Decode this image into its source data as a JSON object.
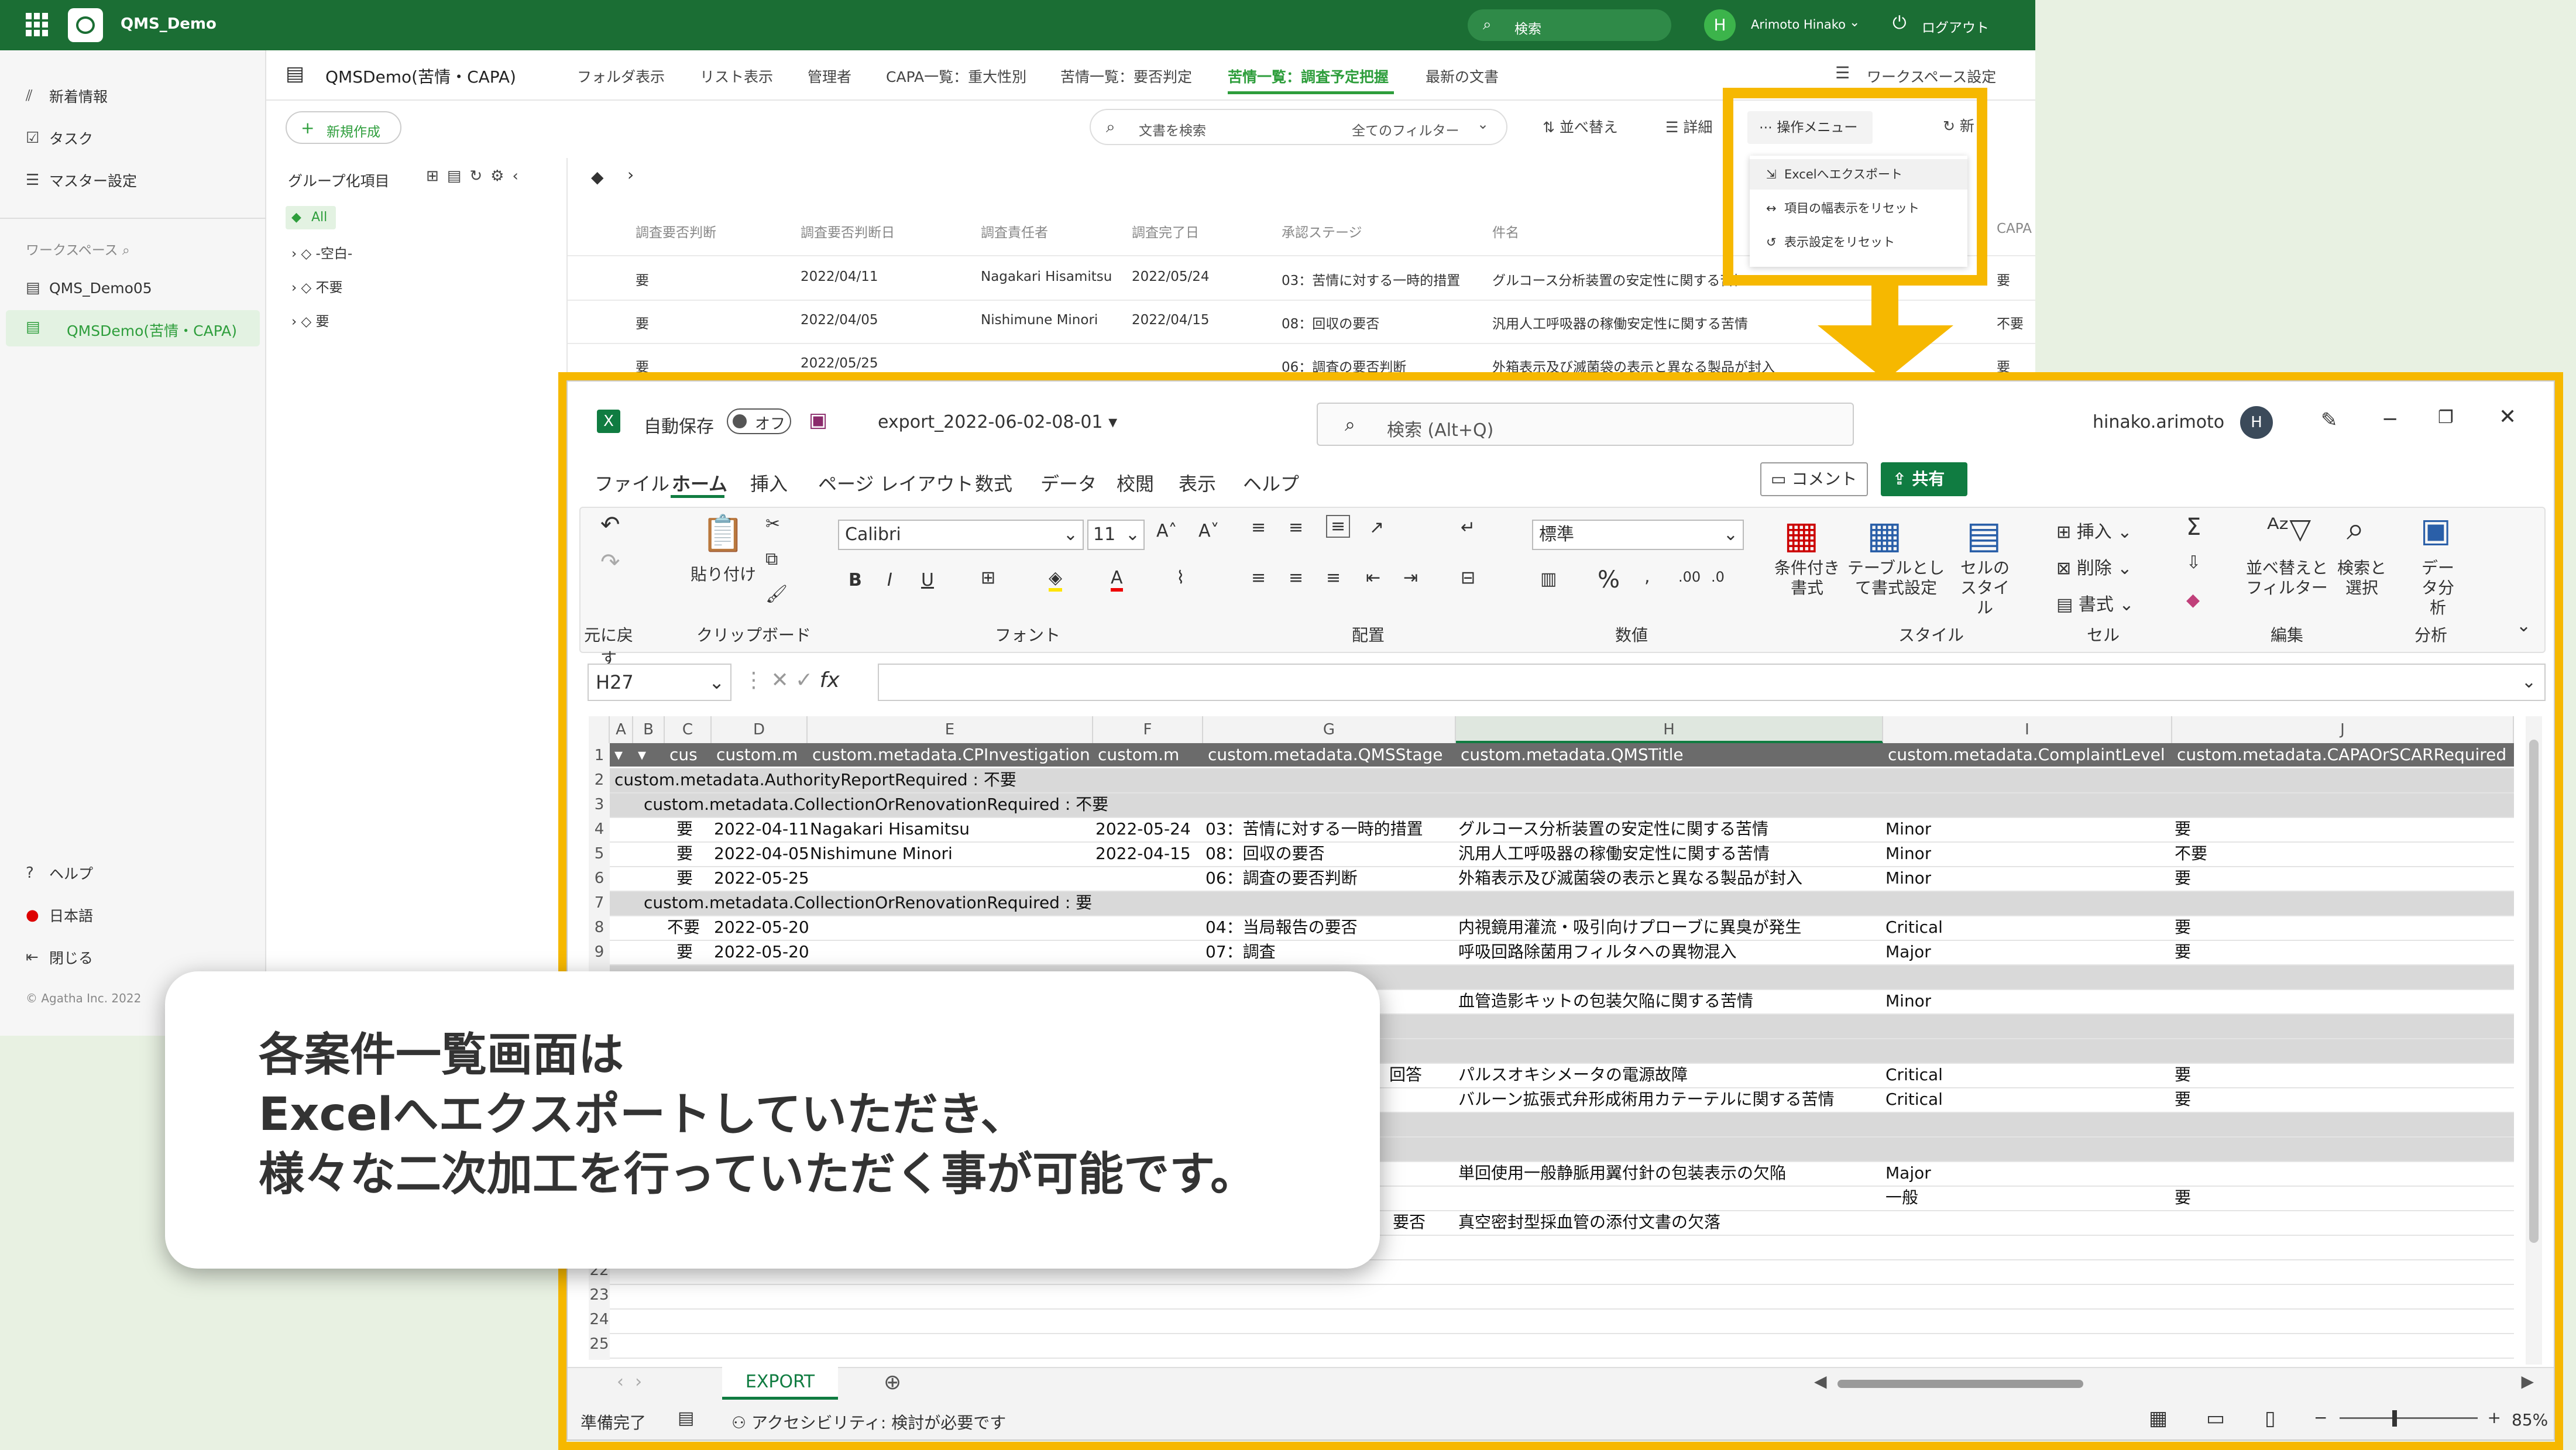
{
  "qms": {
    "app_title": "QMS_Demo",
    "search_placeholder": "検索",
    "user_initial": "H",
    "user_name": "Arimoto Hinako",
    "logout": "ログアウト",
    "nav": {
      "news": "新着情報",
      "task": "タスク",
      "master": "マスター設定",
      "workspace_header": "ワークスペース",
      "ws1": "QMS_Demo05",
      "ws2": "QMSDemo(苦情・CAPA)",
      "help": "ヘルプ",
      "lang": "日本語",
      "close": "閉じる",
      "copyright": "© Agatha Inc. 2022"
    },
    "workspace_title": "QMSDemo(苦情・CAPA)",
    "tabs": [
      "フォルダ表示",
      "リスト表示",
      "管理者",
      "CAPA一覧：重大性別",
      "苦情一覧：要否判定",
      "苦情一覧：調査予定把握",
      "最新の文書"
    ],
    "workspace_settings": "ワークスペース設定",
    "new_button": "新規作成",
    "doc_search_placeholder": "文書を検索",
    "all_filters": "全てのフィルター",
    "sort": "並べ替え",
    "detail": "詳細",
    "ops_menu": "操作メニュー",
    "refresh": "新",
    "ops_items": [
      "Excelへエクスポート",
      "項目の幅表示をリセット",
      "表示設定をリセット"
    ],
    "group_title": "グループ化項目",
    "groups": [
      "All",
      "-空白-",
      "不要",
      "要"
    ],
    "grid_headers": [
      "調査要否判断",
      "調査要否判断日",
      "調査責任者",
      "調査完了日",
      "承認ステージ",
      "件名",
      "CAPA"
    ],
    "grid_rows": [
      [
        "要",
        "2022/04/11",
        "Nagakari Hisamitsu",
        "2022/05/24",
        "03：苦情に対する一時的措置",
        "グルコース分析装置の安定性に関する苦情",
        "要"
      ],
      [
        "要",
        "2022/04/05",
        "Nishimune Minori",
        "2022/04/15",
        "08：回収の要否",
        "汎用人工呼吸器の稼働安定性に関する苦情",
        "不要"
      ],
      [
        "要",
        "2022/05/25",
        "",
        "",
        "06：調査の要否判断",
        "外箱表示及び滅菌袋の表示と異なる製品が封入",
        "要"
      ]
    ]
  },
  "excel": {
    "autosave": "自動保存",
    "autosave_state": "オフ",
    "filename": "export_2022-06-02-08-01",
    "search": "検索 (Alt+Q)",
    "user": "hinako.arimoto",
    "user_initial": "H",
    "menu": [
      "ファイル",
      "ホーム",
      "挿入",
      "ページ レイアウト",
      "数式",
      "データ",
      "校閲",
      "表示",
      "ヘルプ"
    ],
    "comment": "コメント",
    "share": "共有",
    "font": "Calibri",
    "font_size": "11",
    "number_format": "標準",
    "paste": "貼り付け",
    "cond_format": "条件付き書式",
    "table_format": "テーブルとして書式設定",
    "cell_style": "セルのスタイル",
    "insert": "挿入",
    "delete": "削除",
    "format": "書式",
    "sort_filter": "並べ替えとフィルター",
    "find_select": "検索と選択",
    "data_analysis": "データ分析",
    "groups": [
      "元に戻す",
      "クリップボード",
      "フォント",
      "配置",
      "数値",
      "スタイル",
      "セル",
      "編集",
      "分析"
    ],
    "name_box": "H27",
    "fx": "fx",
    "col_letters": [
      "A",
      "B",
      "C",
      "D",
      "E",
      "F",
      "G",
      "H",
      "I",
      "J"
    ],
    "header_cells": [
      "cus",
      "custom.m",
      "custom.metadata.CPInvestigation",
      "custom.m",
      "custom.metadata.QMSStage",
      "custom.metadata.QMSTitle",
      "custom.metadata.ComplaintLevel",
      "custom.metadata.CAPAOrSCARRequired"
    ],
    "group1": "custom.metadata.AuthorityReportRequired : 不要",
    "group2": "custom.metadata.CollectionOrRenovationRequired : 不要",
    "group3": "custom.metadata.CollectionOrRenovationRequired : 要",
    "rows": [
      [
        "要",
        "2022-04-11",
        "Nagakari Hisamitsu",
        "2022-05-24",
        "03：苦情に対する一時的措置",
        "グルコース分析装置の安定性に関する苦情",
        "Minor",
        "要"
      ],
      [
        "要",
        "2022-04-05",
        "Nishimune Minori",
        "2022-04-15",
        "08：回収の要否",
        "汎用人工呼吸器の稼働安定性に関する苦情",
        "Minor",
        "不要"
      ],
      [
        "要",
        "2022-05-25",
        "",
        "",
        "06：調査の要否判断",
        "外箱表示及び滅菌袋の表示と異なる製品が封入",
        "Minor",
        "要"
      ],
      [
        "不要",
        "2022-05-20",
        "",
        "",
        "04：当局報告の要否",
        "内視鏡用灌流・吸引向けプローブに異臭が発生",
        "Critical",
        "要"
      ],
      [
        "要",
        "2022-05-20",
        "",
        "",
        "07：調査",
        "呼吸回路除菌用フィルタへの異物混入",
        "Major",
        "要"
      ]
    ],
    "partial_rows": [
      {
        "g": "",
        "h": "血管造影キットの包装欠陥に関する苦情",
        "i": "Minor",
        "j": ""
      },
      {
        "g": "回答",
        "h": "パルスオキシメータの電源故障",
        "i": "Critical",
        "j": "要"
      },
      {
        "g": "",
        "h": "バルーン拡張式弁形成術用カテーテルに関する苦情",
        "i": "Critical",
        "j": "要"
      },
      {
        "g": "",
        "h": "単回使用一般静脈用翼付針の包装表示の欠陥",
        "i": "Major",
        "j": ""
      },
      {
        "g": "",
        "h": "",
        "i": "一般",
        "j": "要"
      },
      {
        "g": "要否",
        "h": "真空密封型採血管の添付文書の欠落",
        "i": "",
        "j": ""
      }
    ],
    "row_numbers": [
      "1",
      "2",
      "3",
      "4",
      "5",
      "6",
      "7",
      "8",
      "9",
      "22",
      "23",
      "24",
      "25"
    ],
    "sheet_tab": "EXPORT",
    "status_ready": "準備完了",
    "accessibility": "アクセシビリティ: 検討が必要です",
    "zoom": "85%"
  },
  "callout": {
    "line1": "各案件一覧画面は",
    "line2": "Excelへエクスポートしていただき、",
    "line3": "様々な二次加工を行っていただく事が可能です。"
  },
  "colors": {
    "green": "#1b6e34",
    "highlight": "#f6b800",
    "excel_green": "#107c41"
  }
}
